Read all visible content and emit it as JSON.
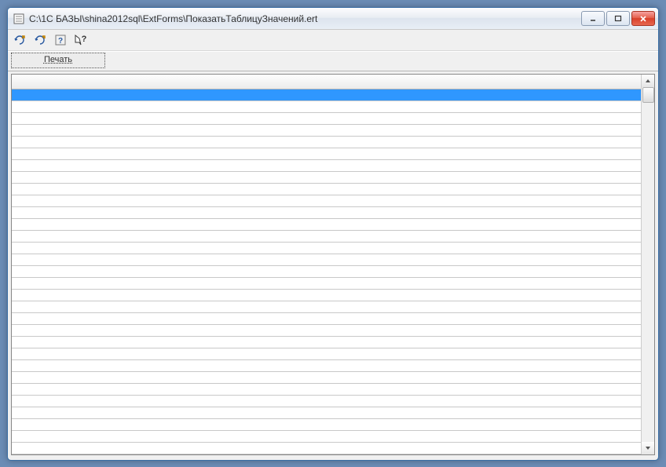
{
  "window": {
    "title": "C:\\1С БАЗЫ\\shina2012sql\\ExtForms\\ПоказатьТаблицуЗначений.ert"
  },
  "toolbar": {
    "print_label": "Печать"
  },
  "grid": {
    "row_count": 31,
    "selected_index": 0
  }
}
